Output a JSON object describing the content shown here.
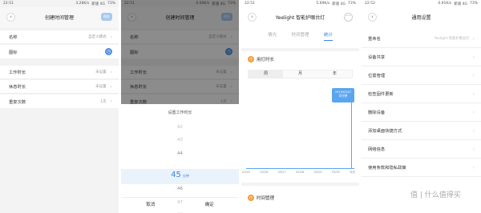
{
  "phone1": {
    "status": {
      "time": "22:51",
      "network": "3.28K/s",
      "signal": "新速 4G",
      "battery": "73%"
    },
    "header": {
      "title": "创建时间管理",
      "confirm": "保存"
    },
    "rows": [
      {
        "label": "名称",
        "value": "自定义模式"
      },
      {
        "label": "图标",
        "value": ""
      },
      {
        "label": "工作时长",
        "value": "未设置"
      },
      {
        "label": "休息时长",
        "value": "未设置"
      },
      {
        "label": "重复次数",
        "value": "1次"
      }
    ]
  },
  "phone2": {
    "status": {
      "time": "22:51",
      "network": "0.00K/s",
      "signal": "新速 4G",
      "battery": "73%"
    },
    "header": {
      "title": "创建时间管理",
      "confirm": "保存"
    },
    "rows": [
      {
        "label": "名称",
        "value": "自定义模式"
      },
      {
        "label": "图标",
        "value": ""
      },
      {
        "label": "工作时长",
        "value": "未设置"
      },
      {
        "label": "休息时长",
        "value": "未设置"
      },
      {
        "label": "重复次数",
        "value": "1次"
      }
    ],
    "sheet": {
      "title": "设置工作时长",
      "numbers": [
        "42",
        "43",
        "44",
        "46",
        "47",
        "48"
      ],
      "selected": "45",
      "unit": "分钟",
      "cancel": "取消",
      "confirm": "确定"
    }
  },
  "phone3": {
    "status": {
      "time": "22:51",
      "network": "5.69K/s",
      "signal": "新速 4G",
      "battery": "73%"
    },
    "header": {
      "title": "Yeelight 智能护眼台灯"
    },
    "tabs": [
      "情光",
      "时间管理",
      "统计"
    ],
    "section1": "用灯时长",
    "periods": [
      "周",
      "月",
      "年"
    ],
    "bubble": {
      "date": "2019/03/07",
      "value": "0分钟"
    },
    "x_ticks": [
      "03/20",
      "03/26",
      "03/27",
      "03/28",
      "03/29",
      "03/30",
      "今天"
    ],
    "section2": "时间管理"
  },
  "phone4": {
    "status": {
      "time": "22:52",
      "network": "0.91K/s",
      "signal": "新速 4G",
      "battery": "73%"
    },
    "header": {
      "title": "通用设置"
    },
    "rows": [
      {
        "label": "重命名",
        "value": "Yeelight 智能护眼台灯"
      },
      {
        "label": "设备共享",
        "value": ""
      },
      {
        "label": "位置管理",
        "value": ""
      },
      {
        "label": "检查固件更新",
        "value": ""
      },
      {
        "label": "删除设备",
        "value": ""
      },
      {
        "label": "添加桌面快捷方式",
        "value": ""
      },
      {
        "label": "网络信息",
        "value": ""
      },
      {
        "label": "使用条款和隐私政策",
        "value": ""
      }
    ]
  },
  "watermark": "值 | 什么值得买",
  "colors": {
    "accent": "#3a87e0",
    "orange": "#f39c38"
  }
}
